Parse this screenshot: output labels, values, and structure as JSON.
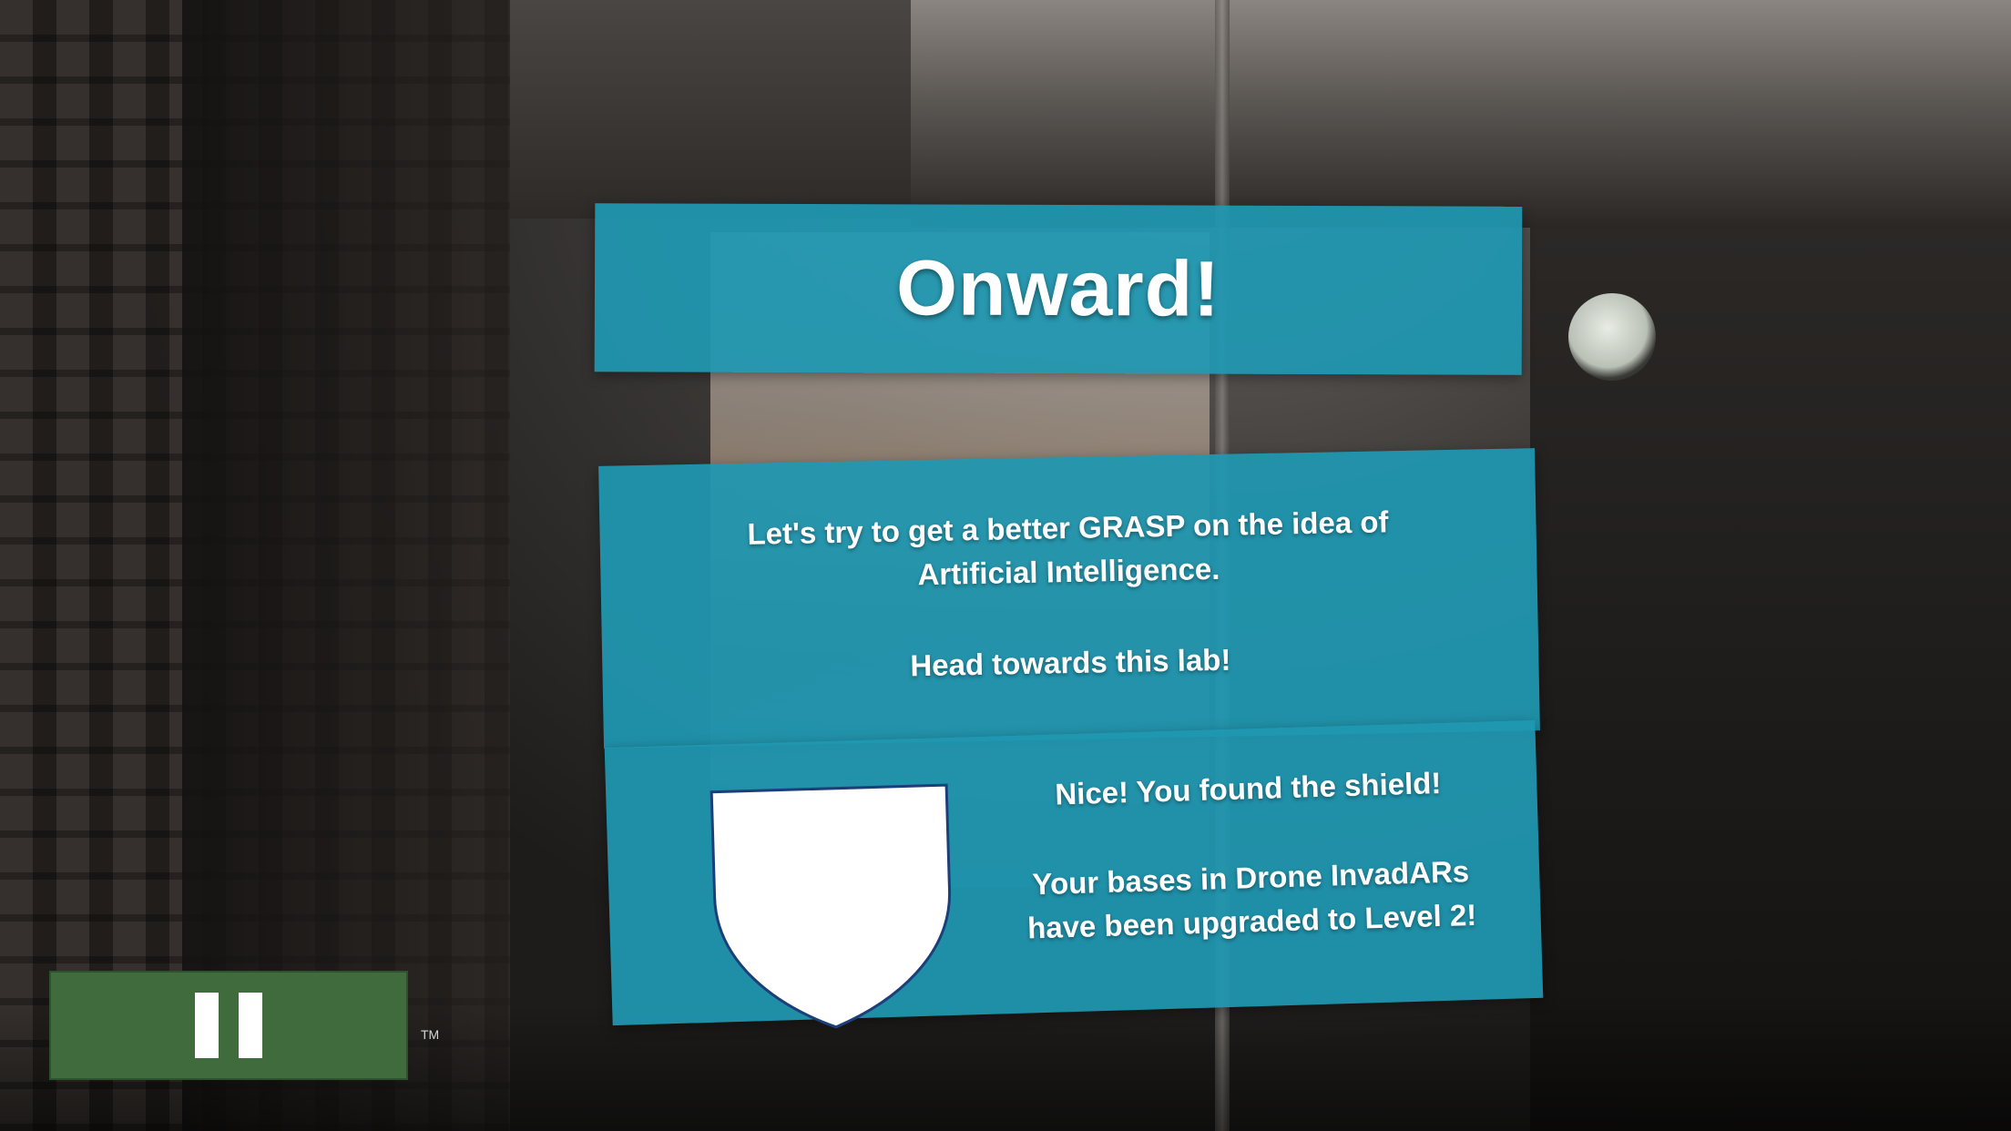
{
  "title_panel": {
    "title": "Onward!"
  },
  "message_panel": {
    "line1": "Let's try to get a better GRASP on the idea of",
    "line2": "Artificial Intelligence.",
    "line3": "Head towards this lab!"
  },
  "shield_panel": {
    "icon": "shield-icon",
    "line1": "Nice! You found the shield!",
    "line2": "Your bases in Drone InvadARs",
    "line3": "have been upgraded to Level 2!"
  },
  "controls": {
    "pause_icon": "pause-icon",
    "trademark": "TM"
  },
  "colors": {
    "panel": "#1f98b2",
    "pause_button": "#3f6b3d",
    "shield_fill": "#ffffff",
    "shield_outline": "#1c3f7a"
  }
}
